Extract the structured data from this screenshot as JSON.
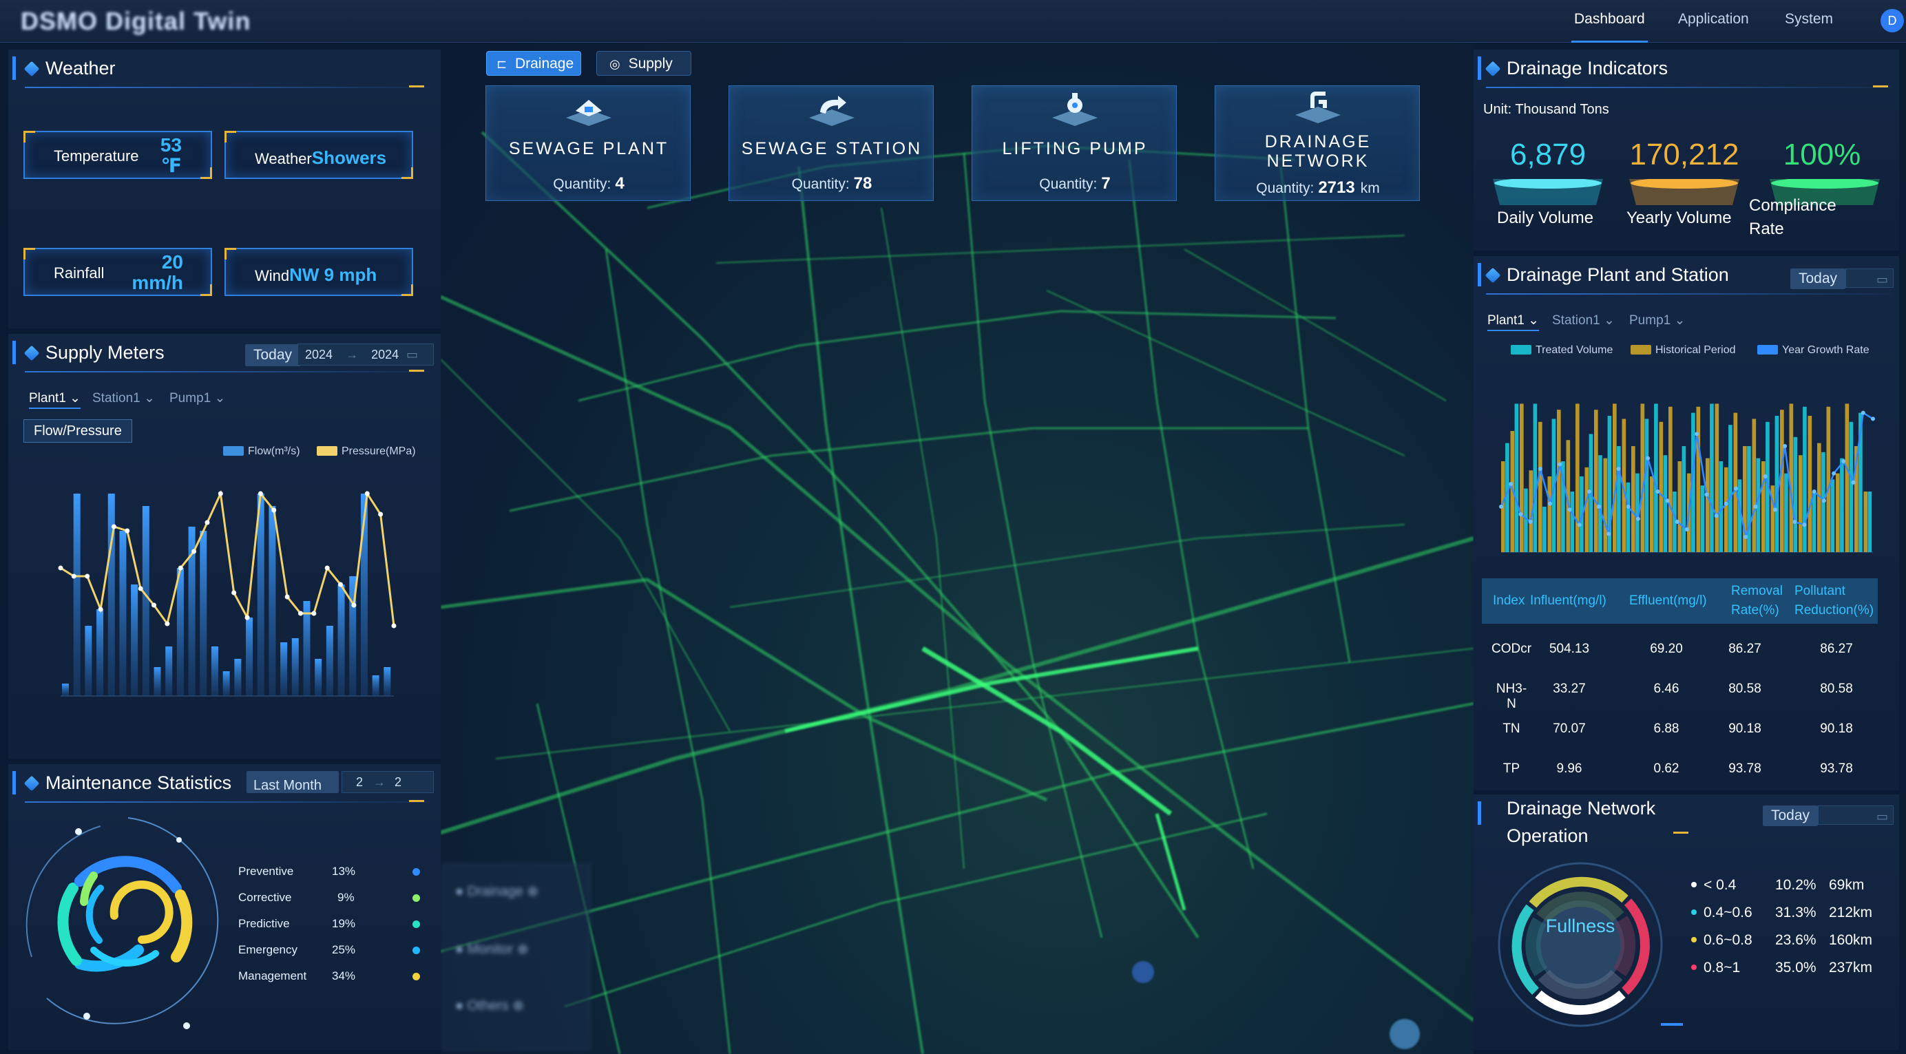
{
  "app": {
    "title": "DSMO Digital Twin"
  },
  "nav": {
    "items": [
      "Dashboard",
      "Application",
      "System"
    ],
    "active": "Dashboard",
    "user_initial": "D"
  },
  "weather": {
    "title": "Weather",
    "temperature": {
      "label": "Temperature",
      "value": "53",
      "unit": "℉"
    },
    "condition": {
      "label": "Weather",
      "value": "Showers"
    },
    "rainfall": {
      "label": "Rainfall",
      "value": "20",
      "unit": "mm/h"
    },
    "wind": {
      "label": "Wind",
      "value": "NW 9 mph"
    }
  },
  "supply_meters": {
    "title": "Supply Meters",
    "today": "Today",
    "range_start": "2024",
    "range_sep": "→",
    "range_end": "2024",
    "filters": [
      "Plant1",
      "Station1",
      "Pump1"
    ],
    "tag": "Flow/Pressure"
  },
  "maintenance": {
    "title": "Maintenance Statistics",
    "period": "Last Month",
    "range_start": "2",
    "range_end": "2",
    "items": [
      {
        "name": "Preventive",
        "pct": "13%",
        "color": "#2f8bff"
      },
      {
        "name": "Corrective",
        "pct": "9%",
        "color": "#8ff06b"
      },
      {
        "name": "Predictive",
        "pct": "19%",
        "color": "#27e3c6"
      },
      {
        "name": "Emergency",
        "pct": "25%",
        "color": "#1fb8ff"
      },
      {
        "name": "Management",
        "pct": "34%",
        "color": "#f2d33b"
      }
    ]
  },
  "top_toggle": {
    "drainage": "Drainage",
    "supply": "Supply",
    "active": "Drainage"
  },
  "facility_cards": [
    {
      "title_line1": "SEWAGE PLANT",
      "title_line2": "",
      "qty_label": "Quantity:",
      "qty": "4",
      "unit": ""
    },
    {
      "title_line1": "SEWAGE STATION",
      "title_line2": "",
      "qty_label": "Quantity:",
      "qty": "78",
      "unit": ""
    },
    {
      "title_line1": "LIFTING PUMP",
      "title_line2": "",
      "qty_label": "Quantity:",
      "qty": "7",
      "unit": ""
    },
    {
      "title_line1": "DRAINAGE",
      "title_line2": "NETWORK",
      "qty_label": "Quantity:",
      "qty": "2713",
      "unit": "km"
    }
  ],
  "drainage_indicators": {
    "title": "Drainage Indicators",
    "unit_text": "Unit:  Thousand Tons",
    "daily": {
      "value": "6,879",
      "label": "Daily Volume",
      "color": "#38d6f0"
    },
    "yearly": {
      "value": "170,212",
      "label": "Yearly Volume",
      "color": "#f0b23a"
    },
    "compliance": {
      "value": "100%",
      "label_line1": "Compliance",
      "label_line2": "Rate",
      "color": "#34e27a"
    }
  },
  "plant_station": {
    "title": "Drainage Plant and Station",
    "today": "Today",
    "filters": [
      "Plant1",
      "Station1",
      "Pump1"
    ],
    "legend": [
      {
        "name": "Treated Volume",
        "color": "#19b6c9"
      },
      {
        "name": "Historical Period",
        "color": "#b8962a"
      },
      {
        "name": "Year Growth Rate",
        "color": "#2f8bff"
      }
    ],
    "table": {
      "headers": [
        "Index",
        "Influent(mg/l)",
        "Effluent(mg/l)",
        "Removal Rate(%)",
        "Pollutant Reduction(%)"
      ],
      "rows": [
        [
          "CODcr",
          "504.13",
          "69.20",
          "86.27",
          "86.27"
        ],
        [
          "NH3-N",
          "33.27",
          "6.46",
          "80.58",
          "80.58"
        ],
        [
          "TN",
          "70.07",
          "6.88",
          "90.18",
          "90.18"
        ],
        [
          "TP",
          "9.96",
          "0.62",
          "93.78",
          "93.78"
        ]
      ]
    }
  },
  "network_operation": {
    "title_line1": "Drainage Network",
    "title_line2": "Operation",
    "today": "Today",
    "center_label": "Fullness",
    "items": [
      {
        "range": "< 0.4",
        "pct": "10.2%",
        "len": "69km",
        "color": "#ffffff"
      },
      {
        "range": "0.4~0.6",
        "pct": "31.3%",
        "len": "212km",
        "color": "#27d3e3"
      },
      {
        "range": "0.6~0.8",
        "pct": "23.6%",
        "len": "160km",
        "color": "#f2d33b"
      },
      {
        "range": "0.8~1",
        "pct": "35.0%",
        "len": "237km",
        "color": "#ff3d6b"
      }
    ]
  }
}
